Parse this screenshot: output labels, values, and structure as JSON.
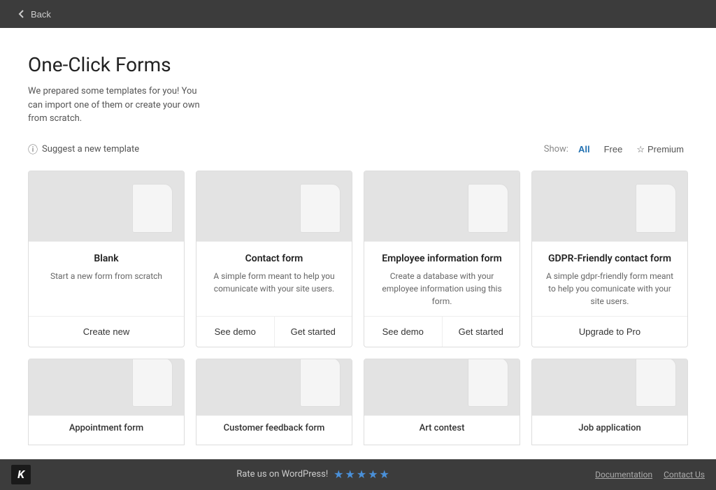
{
  "topbar": {
    "back_label": "Back"
  },
  "header": {
    "title": "One-Click Forms",
    "subtitle": "We prepared some templates for you! You can import one of them or create your own from scratch."
  },
  "toolbar": {
    "suggest_label": "Suggest a new template",
    "show_label": "Show:",
    "filter_all": "All",
    "filter_free": "Free",
    "filter_premium": "Premium",
    "star_icon": "☆"
  },
  "cards": [
    {
      "id": "blank",
      "title": "Blank",
      "description": "Start a new form from scratch",
      "actions": [
        {
          "label": "Create new",
          "type": "primary"
        }
      ]
    },
    {
      "id": "contact-form",
      "title": "Contact form",
      "description": "A simple form meant to help you comunicate with your site users.",
      "actions": [
        {
          "label": "See demo",
          "type": "secondary"
        },
        {
          "label": "Get started",
          "type": "secondary"
        }
      ]
    },
    {
      "id": "employee-information-form",
      "title": "Employee information form",
      "description": "Create a database with your employee information using this form.",
      "actions": [
        {
          "label": "See demo",
          "type": "secondary"
        },
        {
          "label": "Get started",
          "type": "secondary"
        }
      ]
    },
    {
      "id": "gdpr-contact-form",
      "title": "GDPR-Friendly contact form",
      "description": "A simple gdpr-friendly form meant to help you comunicate with your site users.",
      "actions": [
        {
          "label": "Upgrade to Pro",
          "type": "primary"
        }
      ]
    }
  ],
  "partial_cards": [
    {
      "id": "appointment",
      "title": "Appointment form"
    },
    {
      "id": "customer-feedback",
      "title": "Customer feedback form"
    },
    {
      "id": "art-contest",
      "title": "Art contest"
    },
    {
      "id": "job-application",
      "title": "Job application"
    }
  ],
  "footer": {
    "logo": "K",
    "rate_text": "Rate us on WordPress!",
    "stars": [
      "★",
      "★",
      "★",
      "★",
      "★"
    ],
    "links": [
      {
        "label": "Documentation"
      },
      {
        "label": "Contact Us"
      }
    ]
  }
}
